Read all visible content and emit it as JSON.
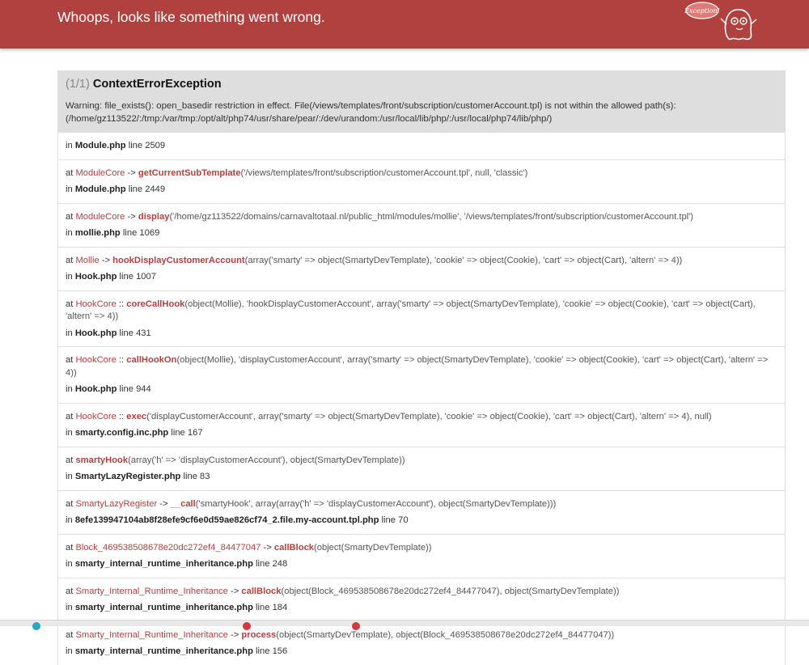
{
  "header": {
    "title": "Whoops, looks like something went wrong.",
    "mascot_text": "Exception!"
  },
  "exception": {
    "count": "(1/1)",
    "name": "ContextErrorException",
    "message": "Warning: file_exists(): open_basedir restriction in effect. File(/views/templates/front/subscription/customerAccount.tpl) is not within the allowed path(s): (/home/gz113522/:/tmp:/var/tmp:/opt/alt/php74/usr/share/pear/:/dev/urandom:/usr/local/lib/php/:/usr/local/php74/lib/php/)"
  },
  "trace": [
    {
      "at": "",
      "class": "",
      "sep": "",
      "func": "",
      "args": "",
      "in_label": "in",
      "file": "Module.php",
      "line_label": "line",
      "line": "2509"
    },
    {
      "at": "at",
      "class": "ModuleCore",
      "sep": "->",
      "func": "getCurrentSubTemplate",
      "args": "('/views/templates/front/subscription/customerAccount.tpl', null, 'classic')",
      "in_label": "in",
      "file": "Module.php",
      "line_label": "line",
      "line": "2449"
    },
    {
      "at": "at",
      "class": "ModuleCore",
      "sep": "->",
      "func": "display",
      "args": "('/home/gz113522/domains/carnavaltotaal.nl/public_html/modules/mollie', '/views/templates/front/subscription/customerAccount.tpl')",
      "in_label": "in",
      "file": "mollie.php",
      "line_label": "line",
      "line": "1069"
    },
    {
      "at": "at",
      "class": "Mollie",
      "sep": "->",
      "func": "hookDisplayCustomerAccount",
      "args": "(array('smarty' => object(SmartyDevTemplate), 'cookie' => object(Cookie), 'cart' => object(Cart), 'altern' => 4))",
      "in_label": "in",
      "file": "Hook.php",
      "line_label": "line",
      "line": "1007"
    },
    {
      "at": "at",
      "class": "HookCore",
      "sep": "::",
      "func": "coreCallHook",
      "args": "(object(Mollie), 'hookDisplayCustomerAccount', array('smarty' => object(SmartyDevTemplate), 'cookie' => object(Cookie), 'cart' => object(Cart), 'altern' => 4))",
      "in_label": "in",
      "file": "Hook.php",
      "line_label": "line",
      "line": "431"
    },
    {
      "at": "at",
      "class": "HookCore",
      "sep": "::",
      "func": "callHookOn",
      "args": "(object(Mollie), 'displayCustomerAccount', array('smarty' => object(SmartyDevTemplate), 'cookie' => object(Cookie), 'cart' => object(Cart), 'altern' => 4))",
      "in_label": "in",
      "file": "Hook.php",
      "line_label": "line",
      "line": "944"
    },
    {
      "at": "at",
      "class": "HookCore",
      "sep": "::",
      "func": "exec",
      "args": "('displayCustomerAccount', array('smarty' => object(SmartyDevTemplate), 'cookie' => object(Cookie), 'cart' => object(Cart), 'altern' => 4), null)",
      "in_label": "in",
      "file": "smarty.config.inc.php",
      "line_label": "line",
      "line": "167"
    },
    {
      "at": "at",
      "class": "",
      "sep": "",
      "func": "smartyHook",
      "args": "(array('h' => 'displayCustomerAccount'), object(SmartyDevTemplate))",
      "in_label": "in",
      "file": "SmartyLazyRegister.php",
      "line_label": "line",
      "line": "83"
    },
    {
      "at": "at",
      "class": "SmartyLazyRegister",
      "sep": "->",
      "func": "__call",
      "args": "('smartyHook', array(array('h' => 'displayCustomerAccount'), object(SmartyDevTemplate)))",
      "in_label": "in",
      "file": "8efe139947104ab8f28efe9cf6e0d59ae826cf74_2.file.my-account.tpl.php",
      "line_label": "line",
      "line": "70"
    },
    {
      "at": "at",
      "class": "Block_469538508678e20dc272ef4_84477047",
      "sep": "->",
      "func": "callBlock",
      "args": "(object(SmartyDevTemplate))",
      "in_label": "in",
      "file": "smarty_internal_runtime_inheritance.php",
      "line_label": "line",
      "line": "248"
    },
    {
      "at": "at",
      "class": "Smarty_Internal_Runtime_Inheritance",
      "sep": "->",
      "func": "callBlock",
      "args": "(object(Block_469538508678e20dc272ef4_84477047), object(SmartyDevTemplate))",
      "in_label": "in",
      "file": "smarty_internal_runtime_inheritance.php",
      "line_label": "line",
      "line": "184"
    },
    {
      "at": "at",
      "class": "Smarty_Internal_Runtime_Inheritance",
      "sep": "->",
      "func": "process",
      "args": "(object(SmartyDevTemplate), object(Block_469538508678e20dc272ef4_84477047))",
      "in_label": "in",
      "file": "smarty_internal_runtime_inheritance.php",
      "line_label": "line",
      "line": "156"
    }
  ],
  "colors": {
    "header_bg": "#b0413e",
    "accent": "#b0413e",
    "panel_head_bg": "#dedede"
  }
}
